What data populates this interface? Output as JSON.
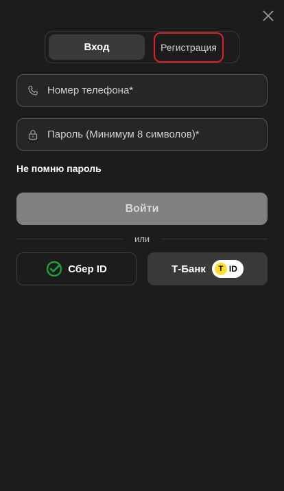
{
  "tabs": {
    "login_label": "Вход",
    "register_label": "Регистрация"
  },
  "form": {
    "phone_placeholder": "Номер телефона*",
    "password_placeholder": "Пароль (Минимум 8 символов)*",
    "phone_icon": "phone-icon",
    "password_icon": "lock-icon"
  },
  "forgot_label": "Не помню пароль",
  "submit_label": "Войти",
  "divider_text": "или",
  "sber": {
    "label": "Сбер ID",
    "icon": "sber-logo-icon"
  },
  "tbank": {
    "label": "Т-Банк",
    "badge_letter": "T",
    "badge_id": "ID"
  },
  "colors": {
    "background": "#1c1c1c",
    "highlight": "#e0202b",
    "sber_green": "#21a038",
    "tbank_yellow": "#ffdd2d"
  }
}
